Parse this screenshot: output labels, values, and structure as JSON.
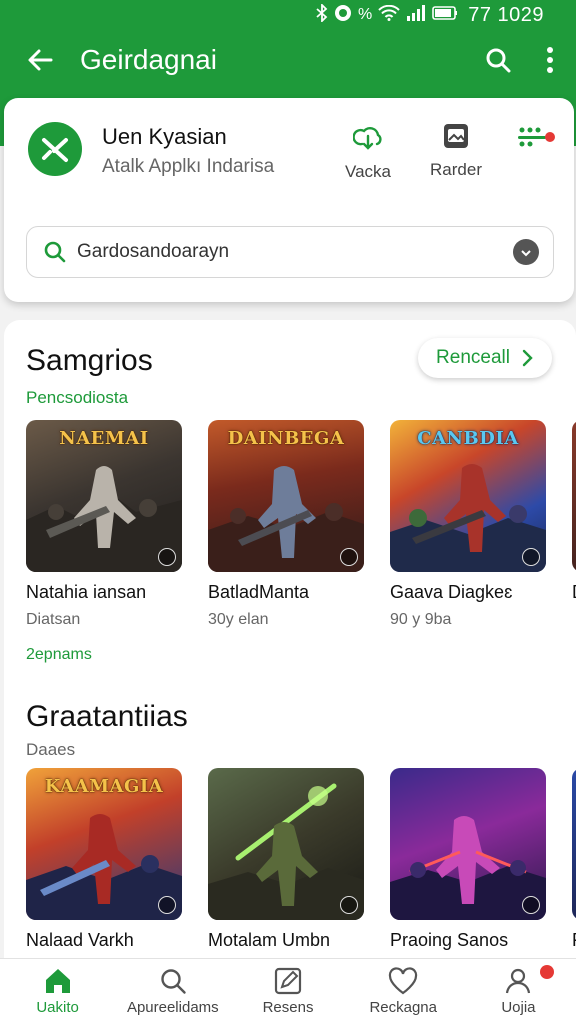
{
  "status_bar": {
    "time": "77 1029",
    "icons": [
      "bluetooth-icon",
      "alarm-icon",
      "percent-icon",
      "wifi-icon",
      "signal-icon",
      "battery-icon"
    ],
    "percent": "%"
  },
  "toolbar": {
    "title": "Geirdagnai"
  },
  "app_card": {
    "name": "Uen Kyasian",
    "subtitle": "Atalk Applkı Indarisa",
    "actions": [
      {
        "icon": "cloud-download-icon",
        "label": "Vacka"
      },
      {
        "icon": "image-icon",
        "label": "Rarder"
      },
      {
        "icon": "more-dots-icon",
        "label": ""
      }
    ],
    "search_text": "Gardosandoarayn"
  },
  "section1": {
    "title": "Samgrios",
    "subtitle": "Pencsodiosta",
    "see_all": "Renceall",
    "more": "2epnams",
    "tiles": [
      {
        "art_title": "NAEMAI",
        "name": "Natahia iansan",
        "meta": "Diatsan"
      },
      {
        "art_title": "DAINBEGA",
        "name": "BatladManta",
        "meta": "30y elan"
      },
      {
        "art_title": "CANBDIA",
        "name": "Gaava Diagkeɛ",
        "meta": "90 y 9ba"
      },
      {
        "art_title": "",
        "name": "D",
        "meta": ""
      }
    ]
  },
  "section2": {
    "title": "Graatantiias",
    "subtitle": "Daaes",
    "tiles": [
      {
        "art_title": "KAAMAGIA",
        "name": "Nalaad Varkh"
      },
      {
        "art_title": "",
        "name": "Motalam Umbn"
      },
      {
        "art_title": "",
        "name": "Praoing Sanos"
      },
      {
        "art_title": "",
        "name": "F"
      }
    ]
  },
  "bottom_nav": [
    {
      "icon": "home-icon",
      "label": "Uakito",
      "active": true
    },
    {
      "icon": "search-icon",
      "label": "Apureelidams",
      "active": false
    },
    {
      "icon": "edit-icon",
      "label": "Resens",
      "active": false
    },
    {
      "icon": "heart-icon",
      "label": "Reckagna",
      "active": false
    },
    {
      "icon": "profile-icon",
      "label": "Uojia",
      "active": false
    }
  ],
  "colors": {
    "brand_green": "#1e9a3a",
    "notification_red": "#e53935"
  }
}
